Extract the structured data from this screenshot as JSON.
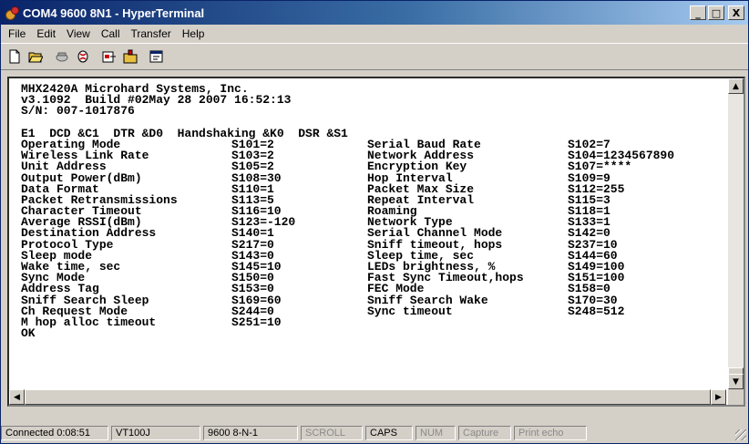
{
  "window": {
    "title": "COM4 9600 8N1 - HyperTerminal",
    "controls": {
      "minimize": "_",
      "maximize": "□",
      "close": "X"
    }
  },
  "menu": [
    "File",
    "Edit",
    "View",
    "Call",
    "Transfer",
    "Help"
  ],
  "toolbar": [
    "new-icon",
    "open-icon",
    "disconnect-icon",
    "dial-icon",
    "send-icon",
    "receive-icon",
    "properties-icon"
  ],
  "terminal": {
    "header": [
      "MHX2420A Microhard Systems, Inc.",
      "v3.1092  Build #02May 28 2007 16:52:13",
      "S/N: 007-1017876",
      ""
    ],
    "flags": "E1  DCD &C1  DTR &D0  Handshaking &K0  DSR &S1",
    "registers": [
      [
        "Operating Mode",
        "S101=2",
        "Serial Baud Rate",
        "S102=7"
      ],
      [
        "Wireless Link Rate",
        "S103=2",
        "Network Address",
        "S104=1234567890"
      ],
      [
        "Unit Address",
        "S105=2",
        "Encryption Key",
        "S107=****"
      ],
      [
        "Output Power(dBm)",
        "S108=30",
        "Hop Interval",
        "S109=9"
      ],
      [
        "Data Format",
        "S110=1",
        "Packet Max Size",
        "S112=255"
      ],
      [
        "Packet Retransmissions",
        "S113=5",
        "Repeat Interval",
        "S115=3"
      ],
      [
        "Character Timeout",
        "S116=10",
        "Roaming",
        "S118=1"
      ],
      [
        "Average RSSI(dBm)",
        "S123=-120",
        "Network Type",
        "S133=1"
      ],
      [
        "Destination Address",
        "S140=1",
        "Serial Channel Mode",
        "S142=0"
      ],
      [
        "Protocol Type",
        "S217=0",
        "Sniff timeout, hops",
        "S237=10"
      ],
      [
        "Sleep mode",
        "S143=0",
        "Sleep time, sec",
        "S144=60"
      ],
      [
        "Wake time, sec",
        "S145=10",
        "LEDs brightness, %",
        "S149=100"
      ],
      [
        "Sync Mode",
        "S150=0",
        "Fast Sync Timeout,hops",
        "S151=100"
      ],
      [
        "Address Tag",
        "S153=0",
        "FEC Mode",
        "S158=0"
      ],
      [
        "Sniff Search Sleep",
        "S169=60",
        "Sniff Search Wake",
        "S170=30"
      ],
      [
        "Ch Request Mode",
        "S244=0",
        "Sync timeout",
        "S248=512"
      ],
      [
        "M hop alloc timeout",
        "S251=10",
        "",
        ""
      ]
    ],
    "footer": "OK"
  },
  "status": [
    {
      "label": "Connected 0:08:51",
      "active": true
    },
    {
      "label": "VT100J",
      "active": true
    },
    {
      "label": "9600 8-N-1",
      "active": true
    },
    {
      "label": "SCROLL",
      "active": false
    },
    {
      "label": "CAPS",
      "active": true
    },
    {
      "label": "NUM",
      "active": false
    },
    {
      "label": "Capture",
      "active": false
    },
    {
      "label": "Print echo",
      "active": false
    }
  ]
}
